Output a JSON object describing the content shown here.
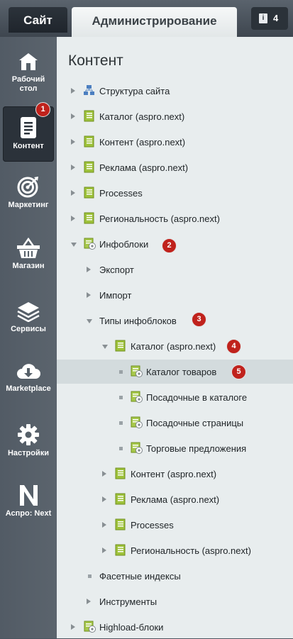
{
  "topbar": {
    "site_tab": "Сайт",
    "admin_tab": "Администрирование",
    "notifications_count": "4",
    "notif_icon": "i"
  },
  "sidebar": {
    "items": [
      {
        "label": "Рабочий стол",
        "icon": "home-icon"
      },
      {
        "label": "Контент",
        "icon": "document-icon",
        "active": true
      },
      {
        "label": "Маркетинг",
        "icon": "target-icon"
      },
      {
        "label": "Магазин",
        "icon": "basket-icon"
      },
      {
        "label": "Сервисы",
        "icon": "layers-icon"
      },
      {
        "label": "Marketplace",
        "icon": "cloud-download-icon"
      },
      {
        "label": "Настройки",
        "icon": "gear-icon"
      },
      {
        "label": "Аспро: Next",
        "icon": "aspro-logo-icon"
      }
    ]
  },
  "main": {
    "title": "Контент"
  },
  "tree": [
    {
      "label": "Структура сайта"
    },
    {
      "label": "Каталог (aspro.next)"
    },
    {
      "label": "Контент (aspro.next)"
    },
    {
      "label": "Реклама (aspro.next)"
    },
    {
      "label": "Processes"
    },
    {
      "label": "Региональность (aspro.next)"
    },
    {
      "label": "Инфоблоки"
    },
    {
      "label": "Экспорт"
    },
    {
      "label": "Импорт"
    },
    {
      "label": "Типы инфоблоков"
    },
    {
      "label": "Каталог (aspro.next)"
    },
    {
      "label": "Каталог товаров"
    },
    {
      "label": "Посадочные в каталоге"
    },
    {
      "label": "Посадочные страницы"
    },
    {
      "label": "Торговые предложения"
    },
    {
      "label": "Контент (aspro.next)"
    },
    {
      "label": "Реклама (aspro.next)"
    },
    {
      "label": "Processes"
    },
    {
      "label": "Региональность (aspro.next)"
    },
    {
      "label": "Фасетные индексы"
    },
    {
      "label": "Инструменты"
    },
    {
      "label": "Highload-блоки"
    }
  ],
  "annotations": [
    "1",
    "2",
    "3",
    "4",
    "5"
  ],
  "colors": {
    "badge": "#c0221c",
    "selected_row": "#d3dbdd",
    "sidebar": "#535c66"
  }
}
